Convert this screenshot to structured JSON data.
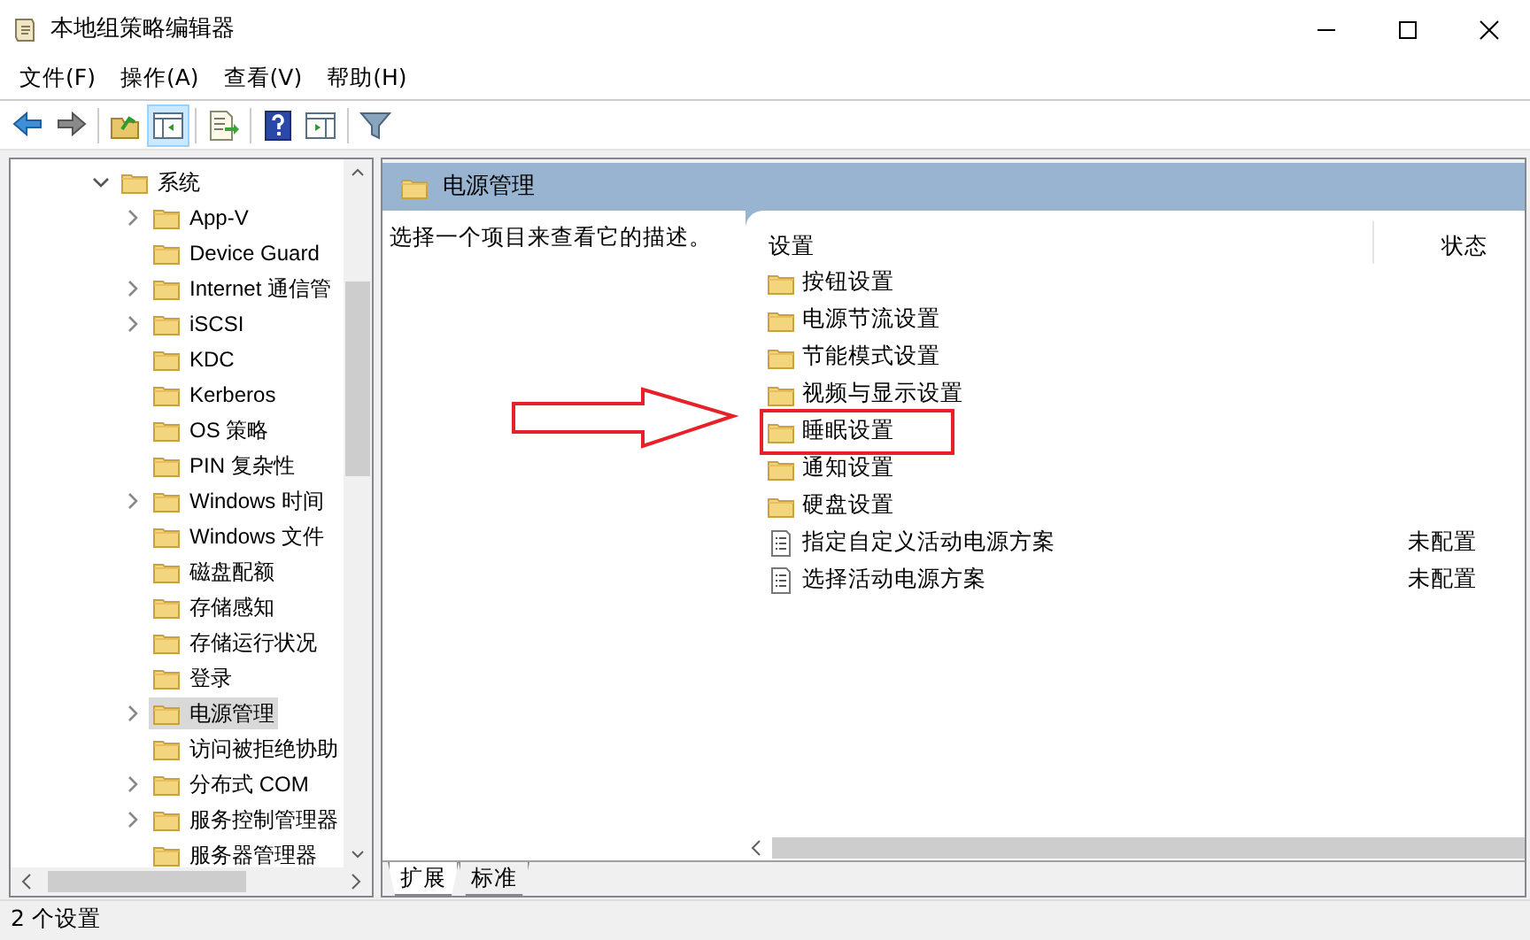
{
  "window": {
    "title": "本地组策略编辑器"
  },
  "menu": [
    "文件(F)",
    "操作(A)",
    "查看(V)",
    "帮助(H)"
  ],
  "toolbar": [
    {
      "kind": "back",
      "pressed": false
    },
    {
      "kind": "forward",
      "pressed": false
    },
    {
      "kind": "sep"
    },
    {
      "kind": "up",
      "pressed": false
    },
    {
      "kind": "tree",
      "pressed": true
    },
    {
      "kind": "sep"
    },
    {
      "kind": "export",
      "pressed": false
    },
    {
      "kind": "sep"
    },
    {
      "kind": "help",
      "pressed": false
    },
    {
      "kind": "pane",
      "pressed": false
    },
    {
      "kind": "sep"
    },
    {
      "kind": "filter",
      "pressed": false
    }
  ],
  "tree": [
    {
      "label": "系统",
      "expanded": true,
      "selected": false,
      "children": [
        {
          "label": "App-V",
          "expandable": true,
          "selected": false
        },
        {
          "label": "Device Guard",
          "expandable": false,
          "selected": false
        },
        {
          "label": "Internet 通信管",
          "expandable": true,
          "selected": false
        },
        {
          "label": "iSCSI",
          "expandable": true,
          "selected": false
        },
        {
          "label": "KDC",
          "expandable": false,
          "selected": false
        },
        {
          "label": "Kerberos",
          "expandable": false,
          "selected": false
        },
        {
          "label": "OS 策略",
          "expandable": false,
          "selected": false
        },
        {
          "label": "PIN 复杂性",
          "expandable": false,
          "selected": false
        },
        {
          "label": "Windows 时间",
          "expandable": true,
          "selected": false
        },
        {
          "label": "Windows 文件",
          "expandable": false,
          "selected": false
        },
        {
          "label": "磁盘配额",
          "expandable": false,
          "selected": false
        },
        {
          "label": "存储感知",
          "expandable": false,
          "selected": false
        },
        {
          "label": "存储运行状况",
          "expandable": false,
          "selected": false
        },
        {
          "label": "登录",
          "expandable": false,
          "selected": false
        },
        {
          "label": "电源管理",
          "expandable": true,
          "selected": true
        },
        {
          "label": "访问被拒绝协助",
          "expandable": false,
          "selected": false
        },
        {
          "label": "分布式 COM",
          "expandable": true,
          "selected": false
        },
        {
          "label": "服务控制管理器",
          "expandable": true,
          "selected": false
        },
        {
          "label": "服务器管理器",
          "expandable": false,
          "selected": false
        }
      ]
    }
  ],
  "details": {
    "title": "电源管理",
    "description": "选择一个项目来查看它的描述。",
    "columns": [
      "设置",
      "状态"
    ],
    "rows": [
      {
        "kind": "folder",
        "name": "按钮设置",
        "annotated": false
      },
      {
        "kind": "folder",
        "name": "电源节流设置",
        "annotated": false
      },
      {
        "kind": "folder",
        "name": "节能模式设置",
        "annotated": false
      },
      {
        "kind": "folder",
        "name": "视频与显示设置",
        "annotated": false
      },
      {
        "kind": "folder",
        "name": "睡眠设置",
        "annotated": true
      },
      {
        "kind": "folder",
        "name": "通知设置",
        "annotated": false
      },
      {
        "kind": "folder",
        "name": "硬盘设置",
        "annotated": false
      },
      {
        "kind": "setting",
        "name": "指定自定义活动电源方案",
        "status": "未配置",
        "annotated": false
      },
      {
        "kind": "setting",
        "name": "选择活动电源方案",
        "status": "未配置",
        "annotated": false
      }
    ]
  },
  "view_tabs": [
    {
      "label": "扩展",
      "selected": true
    },
    {
      "label": "标准",
      "selected": false
    }
  ],
  "status_bar": "2 个设置"
}
